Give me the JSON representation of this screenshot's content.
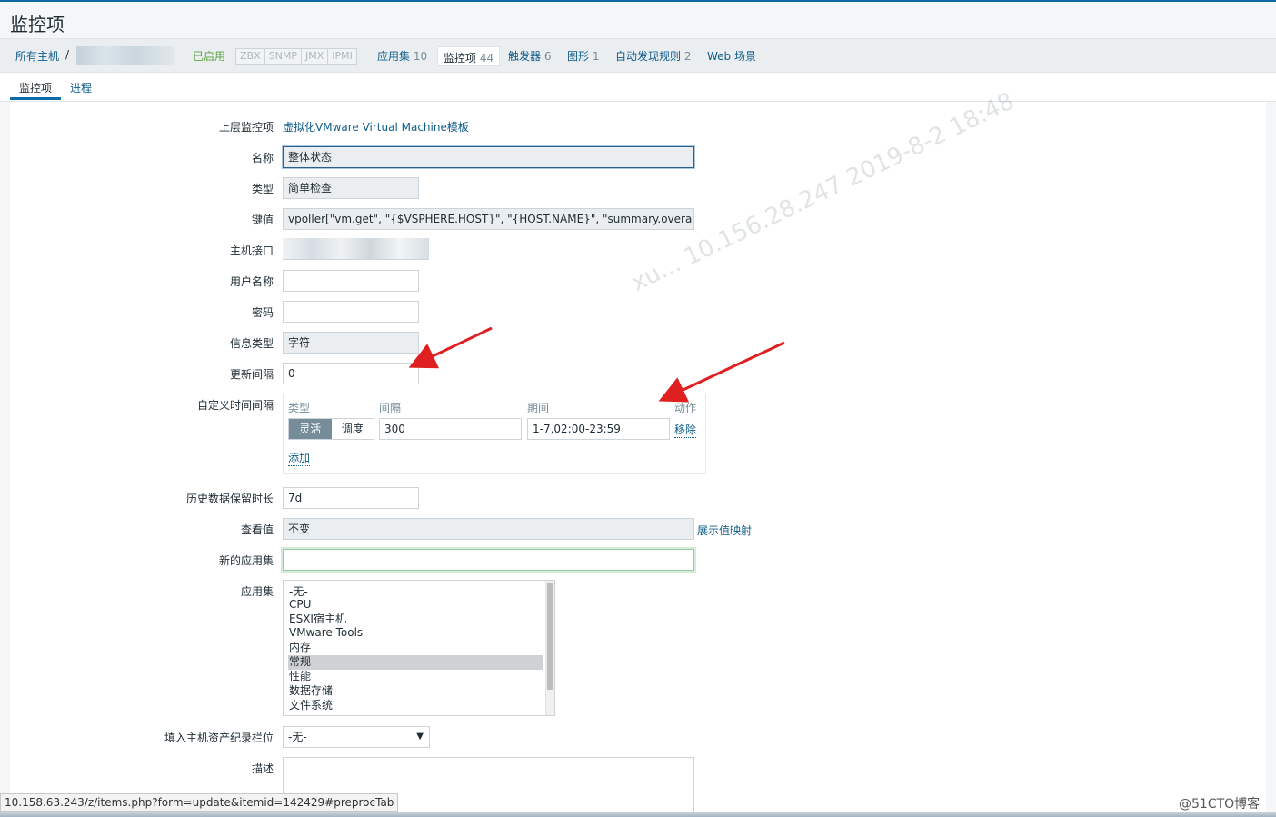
{
  "page": {
    "title": "监控项"
  },
  "hostnav": {
    "all_hosts": "所有主机",
    "separator": "/",
    "enabled": "已启用",
    "protocols": [
      "ZBX",
      "SNMP",
      "JMX",
      "IPMI"
    ],
    "applications": {
      "label": "应用集",
      "count": "10"
    },
    "items": {
      "label": "监控项",
      "count": "44"
    },
    "triggers": {
      "label": "触发器",
      "count": "6"
    },
    "graphs": {
      "label": "图形",
      "count": "1"
    },
    "discovery": {
      "label": "自动发现规则",
      "count": "2"
    },
    "web": {
      "label": "Web 场景"
    }
  },
  "tabs": {
    "items": "监控项",
    "preprocessing": "进程"
  },
  "form": {
    "parent_label": "上层监控项",
    "parent_value": "虚拟化VMware Virtual Machine模板",
    "name_label": "名称",
    "name_value": "整体状态",
    "type_label": "类型",
    "type_value": "简单检查",
    "key_label": "键值",
    "key_value": "vpoller[\"vm.get\", \"{$VSPHERE.HOST}\", \"{HOST.NAME}\", \"summary.overallStatus\",",
    "interface_label": "主机接口",
    "username_label": "用户名称",
    "password_label": "密码",
    "info_type_label": "信息类型",
    "info_type_value": "字符",
    "interval_label": "更新间隔",
    "interval_value": "0",
    "custom_label": "自定义时间间隔",
    "custom": {
      "col_type": "类型",
      "col_interval": "间隔",
      "col_period": "期间",
      "col_action": "动作",
      "flexible": "灵活",
      "scheduling": "调度",
      "interval": "300",
      "period": "1-7,02:00-23:59",
      "remove": "移除",
      "add": "添加"
    },
    "history_label": "历史数据保留时长",
    "history_value": "7d",
    "showvalue_label": "查看值",
    "showvalue_value": "不变",
    "showvalue_link": "展示值映射",
    "newapp_label": "新的应用集",
    "newapp_value": "",
    "apps_label": "应用集",
    "apps": [
      "-无-",
      "CPU",
      "ESXI宿主机",
      "VMware Tools",
      "内存",
      "常规",
      "性能",
      "数据存储",
      "文件系统"
    ],
    "apps_selected": "常规",
    "inventory_label": "填入主机资产纪录栏位",
    "inventory_value": "-无-",
    "description_label": "描述"
  },
  "status_url": "10.158.63.243/z/items.php?form=update&itemid=142429#preprocTab",
  "watermark": "xu... 10.156.28.247   2019-8-2 18:48",
  "brand": "@51CTO博客",
  "colors": {
    "link": "#0f5c8a",
    "accent": "#0e6ba8",
    "enabled": "#59a33f",
    "arrow": "#e02020"
  }
}
